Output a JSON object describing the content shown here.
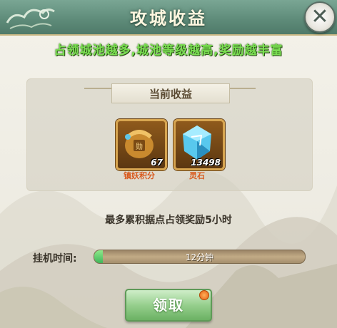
{
  "window": {
    "title": "攻城收益",
    "close_label": "✕"
  },
  "subtitle": "占领城池越多,城池等级越高,奖励越丰富",
  "section": {
    "title": "当前收益"
  },
  "rewards": [
    {
      "name": "镇妖积分",
      "count": "67",
      "icon": "demon-seal-points-icon"
    },
    {
      "name": "灵石",
      "count": "13498",
      "icon": "spirit-stone-icon"
    }
  ],
  "info_text": "最多累积据点占领奖励5小时",
  "timer": {
    "label": "挂机时间:",
    "progress_text": "12分钟",
    "progress_fraction": 0.04
  },
  "claim_button": {
    "label": "领取",
    "has_notification": true
  },
  "colors": {
    "title_bar": "#5f8c7a",
    "subtitle": "#7adf52",
    "reward_name": "#d95a1e",
    "progress_fill": "#3fb65a",
    "button": "#96cf8d",
    "notification_dot": "#e65e12"
  }
}
